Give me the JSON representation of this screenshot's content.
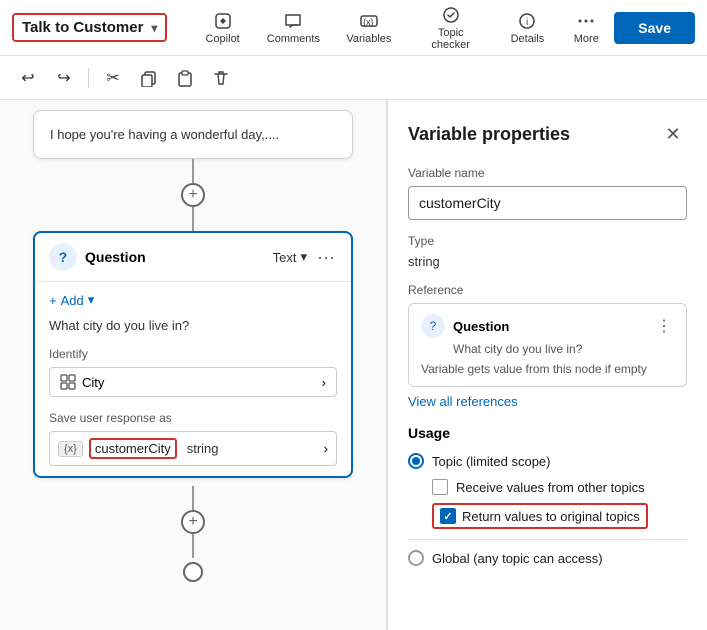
{
  "toolbar": {
    "app_title": "Talk to Customer",
    "save_label": "Save",
    "icons": [
      {
        "id": "copilot",
        "label": "Copilot",
        "symbol": "✦"
      },
      {
        "id": "comments",
        "label": "Comments",
        "symbol": "💬"
      },
      {
        "id": "variables",
        "label": "Variables",
        "symbol": "{x}"
      },
      {
        "id": "topic_checker",
        "label": "Topic checker",
        "symbol": "⊕"
      },
      {
        "id": "details",
        "label": "Details",
        "symbol": "ℹ"
      },
      {
        "id": "more",
        "label": "More",
        "symbol": "···"
      }
    ]
  },
  "toolbar2": {
    "undo": "↩",
    "redo": "↪",
    "cut": "✂",
    "copy": "⧉",
    "paste": "📋",
    "delete": "🗑"
  },
  "canvas": {
    "message_node": {
      "text": "I hope you're having a wonderful day,...."
    },
    "question_node": {
      "title": "Question",
      "type": "Text",
      "add_label": "Add",
      "question_text": "What city do you live in?",
      "identify_label": "Identify",
      "identify_value": "City",
      "save_label": "Save user response as",
      "var_badge": "{x}",
      "var_name": "customerCity",
      "var_type": "string"
    }
  },
  "var_panel": {
    "title": "Variable properties",
    "var_name_label": "Variable name",
    "var_name_value": "customerCity",
    "type_label": "Type",
    "type_value": "string",
    "reference_label": "Reference",
    "ref_title": "Question",
    "ref_subtitle": "What city do you live in?",
    "ref_note": "Variable gets value from this node if empty",
    "view_all": "View all references",
    "usage_label": "Usage",
    "topic_label": "Topic (limited scope)",
    "receive_label": "Receive values from other topics",
    "return_label": "Return values to original topics",
    "global_label": "Global (any topic can access)"
  }
}
